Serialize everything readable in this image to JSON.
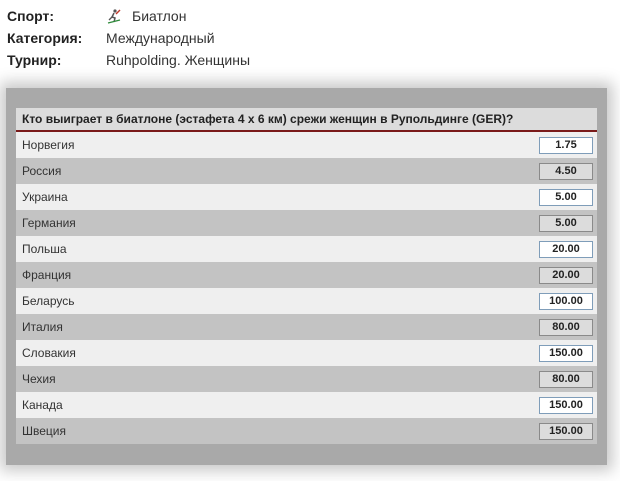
{
  "meta": {
    "sport_label": "Спорт:",
    "sport_value": "Биатлон",
    "sport_icon": "biathlon-icon",
    "category_label": "Категория:",
    "category_value": "Международный",
    "tournament_label": "Турнир:",
    "tournament_value": "Ruhpolding. Женщины"
  },
  "market": {
    "title": "Кто выиграет в биатлоне (эстафета 4 x 6 км) срежи женщин в Рупольдинге (GER)?",
    "accent_color": "#7a1a1a",
    "rows": [
      {
        "team": "Норвегия",
        "odds": "1.75"
      },
      {
        "team": "Россия",
        "odds": "4.50"
      },
      {
        "team": "Украина",
        "odds": "5.00"
      },
      {
        "team": "Германия",
        "odds": "5.00"
      },
      {
        "team": "Польша",
        "odds": "20.00"
      },
      {
        "team": "Франция",
        "odds": "20.00"
      },
      {
        "team": "Беларусь",
        "odds": "100.00"
      },
      {
        "team": "Италия",
        "odds": "80.00"
      },
      {
        "team": "Словакия",
        "odds": "150.00"
      },
      {
        "team": "Чехия",
        "odds": "80.00"
      },
      {
        "team": "Канада",
        "odds": "150.00"
      },
      {
        "team": "Швеция",
        "odds": "150.00"
      }
    ]
  }
}
